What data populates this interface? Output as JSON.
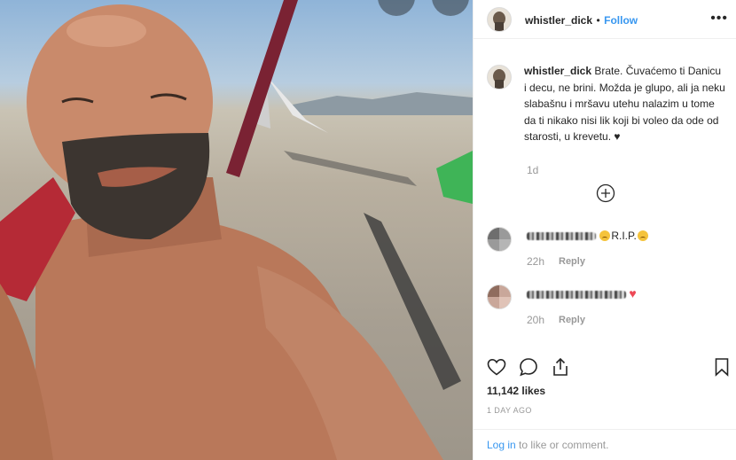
{
  "post": {
    "username": "whistler_dick",
    "separator": "•",
    "follow_label": "Follow",
    "more_label": "•••"
  },
  "caption": {
    "username": "whistler_dick",
    "text": "Brate. Čuvaćemo ti Danicu i decu, ne brini. Možda je glupo, ali ja neku slabašnu i mršavu utehu nalazim u tome da ti nikako nisi lik koji bi voleo da ode od starosti, u krevetu. ♥",
    "time": "1d"
  },
  "comments": [
    {
      "text": "R.I.P.",
      "time": "22h",
      "reply_label": "Reply"
    },
    {
      "text": "♥",
      "time": "20h",
      "reply_label": "Reply"
    }
  ],
  "stats": {
    "likes": "11,142 likes",
    "date": "1 DAY AGO"
  },
  "footer": {
    "login_label": "Log in",
    "rest_label": "to like or comment."
  },
  "colors": {
    "link": "#3897f0",
    "text": "#262626",
    "muted": "#999999",
    "heart": "#ed4956"
  },
  "icons": {
    "like": "heart-outline-icon",
    "comment": "speech-bubble-icon",
    "share": "share-icon",
    "save": "bookmark-icon",
    "load_more": "plus-circle-icon"
  }
}
